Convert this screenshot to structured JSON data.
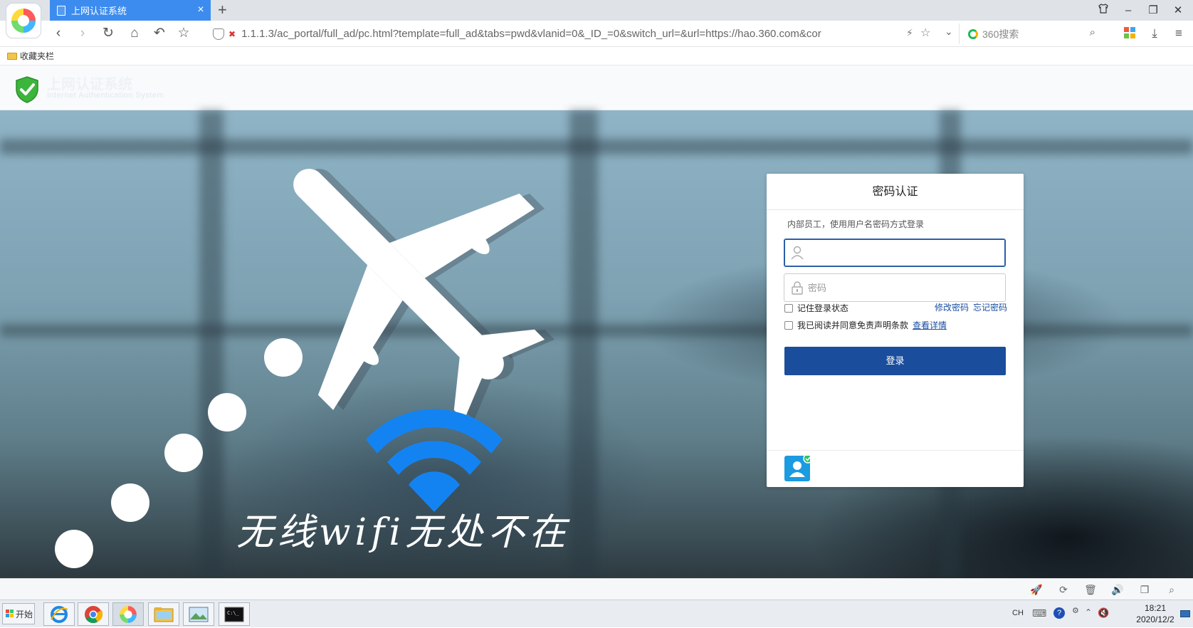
{
  "browser": {
    "tab_title": "上网认证系统",
    "address_url": "1.1.1.3/ac_portal/full_ad/pc.html?template=full_ad&tabs=pwd&vlanid=0&_ID_=0&switch_url=&url=https://hao.360.com&cor",
    "search_placeholder": "360搜索",
    "bookmark_folder": "收藏夹栏"
  },
  "site": {
    "title": "上网认证系统",
    "subtitle": "Internet Authentication System"
  },
  "hero": {
    "slogan": "无线wifi无处不在"
  },
  "login": {
    "title": "密码认证",
    "description": "内部员工，使用用户名密码方式登录",
    "username_value": "",
    "password_placeholder": "密码",
    "remember_label": "记住登录状态",
    "change_password": "修改密码",
    "forgot_password": "忘记密码",
    "agree_label": "我已阅读并同意免责声明条款",
    "view_details": "查看详情",
    "login_button": "登录"
  },
  "taskbar": {
    "start": "开始",
    "ime": "CH",
    "time": "18:21",
    "date": "2020/12/2"
  },
  "colors": {
    "tab_active": "#3c8cf0",
    "login_button": "#1a4d9c",
    "wifi": "#1483f2",
    "link": "#1a4ea0"
  }
}
